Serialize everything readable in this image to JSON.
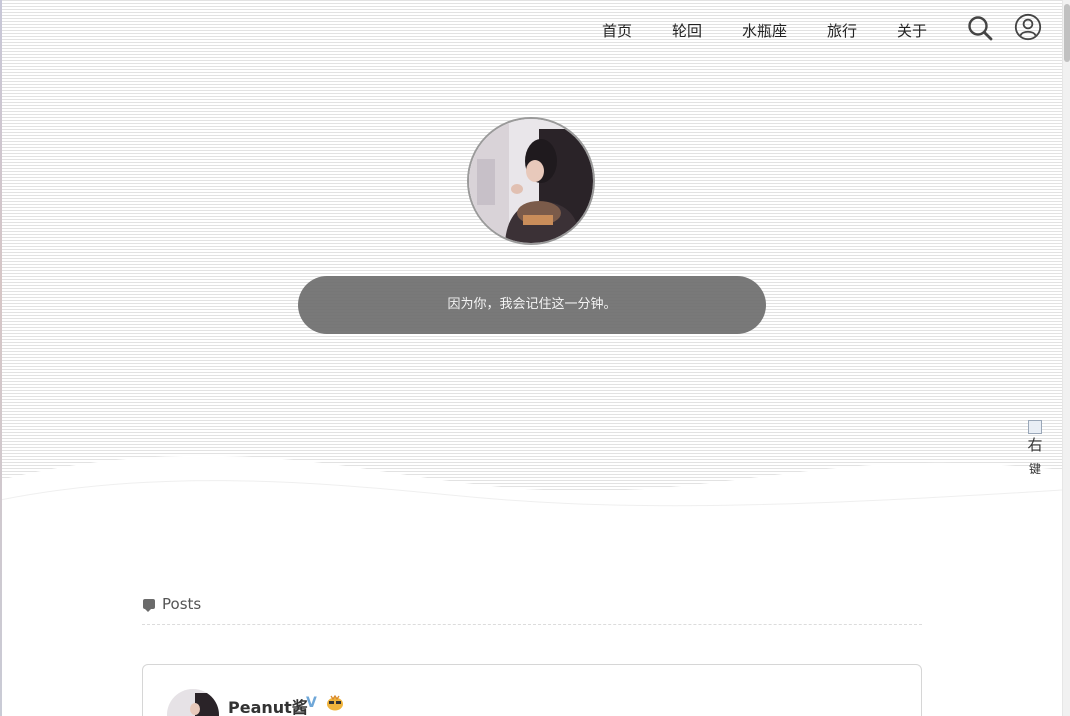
{
  "nav": {
    "items": [
      {
        "label": "首页"
      },
      {
        "label": "轮回"
      },
      {
        "label": "水瓶座"
      },
      {
        "label": "旅行"
      },
      {
        "label": "关于"
      }
    ],
    "search_icon": "search-icon",
    "user_icon": "user-circle-icon"
  },
  "hero": {
    "motto": "因为你，我会记住这一分钟。",
    "avatar_icon": "avatar-photo"
  },
  "side_widget": {
    "label": "右",
    "sub_label": "键"
  },
  "posts": {
    "title": "Posts",
    "icon": "comment-icon",
    "first_post": {
      "author": "Peanut酱",
      "verified_mark": "V",
      "badge_icon": "emoji-badge-icon"
    }
  },
  "colors": {
    "motto_bg": "#6e6e6e",
    "verified": "#6fa7d8",
    "nav_text": "#222222"
  }
}
